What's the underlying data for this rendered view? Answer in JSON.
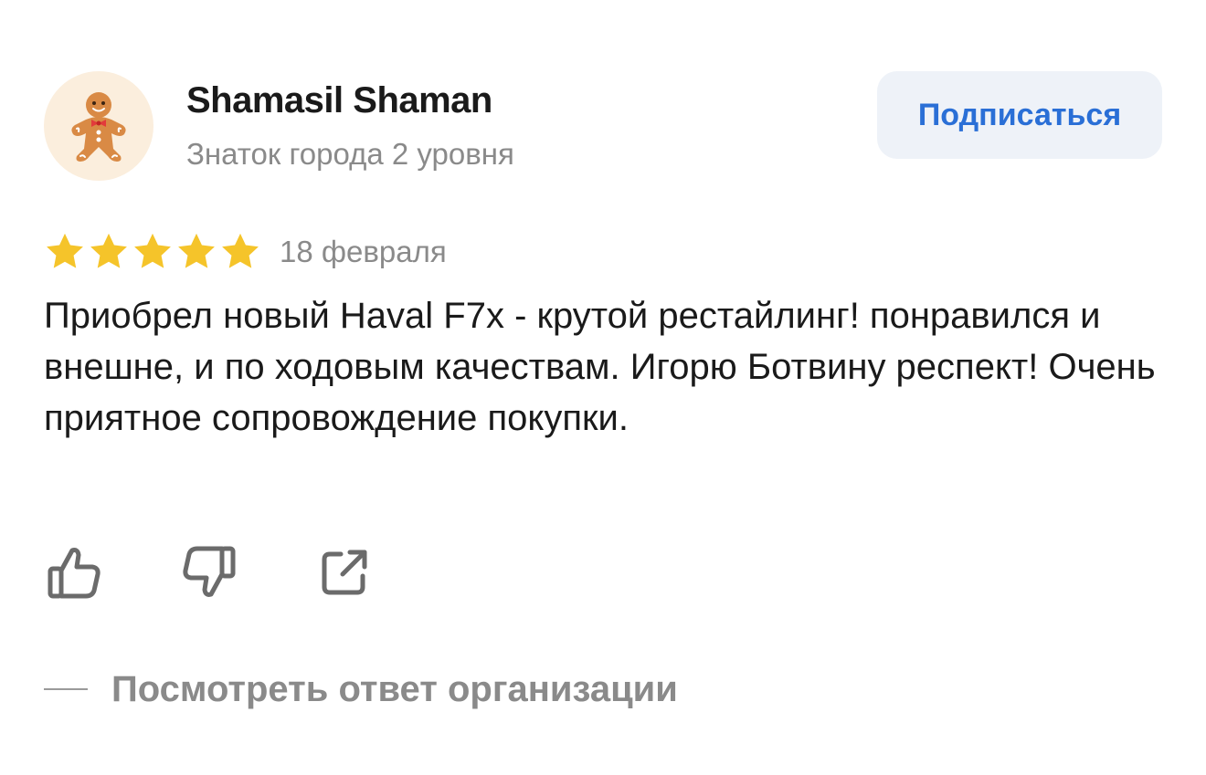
{
  "author": {
    "name": "Shamasil Shaman",
    "level": "Знаток города 2 уровня",
    "avatar_icon": "gingerbread-man-icon"
  },
  "subscribe_button": {
    "label": "Подписаться"
  },
  "rating": {
    "stars": 5,
    "max_stars": 5,
    "star_color": "#f5c42a"
  },
  "date": "18 февраля",
  "review_text": "Приобрел новый Haval F7x - крутой рестайлинг! понравился и внешне, и по ходовым качествам. Игорю Ботвину респект! Очень приятное сопровождение покупки.",
  "actions": [
    {
      "name": "like",
      "icon": "thumbs-up-icon"
    },
    {
      "name": "dislike",
      "icon": "thumbs-down-icon"
    },
    {
      "name": "share",
      "icon": "share-icon"
    }
  ],
  "org_reply": {
    "label": "Посмотреть ответ организации"
  },
  "colors": {
    "accent": "#2a6fd6",
    "muted_text": "#8a8a8a",
    "button_bg": "#eef2f8",
    "icon_stroke": "#6b6b6b"
  }
}
